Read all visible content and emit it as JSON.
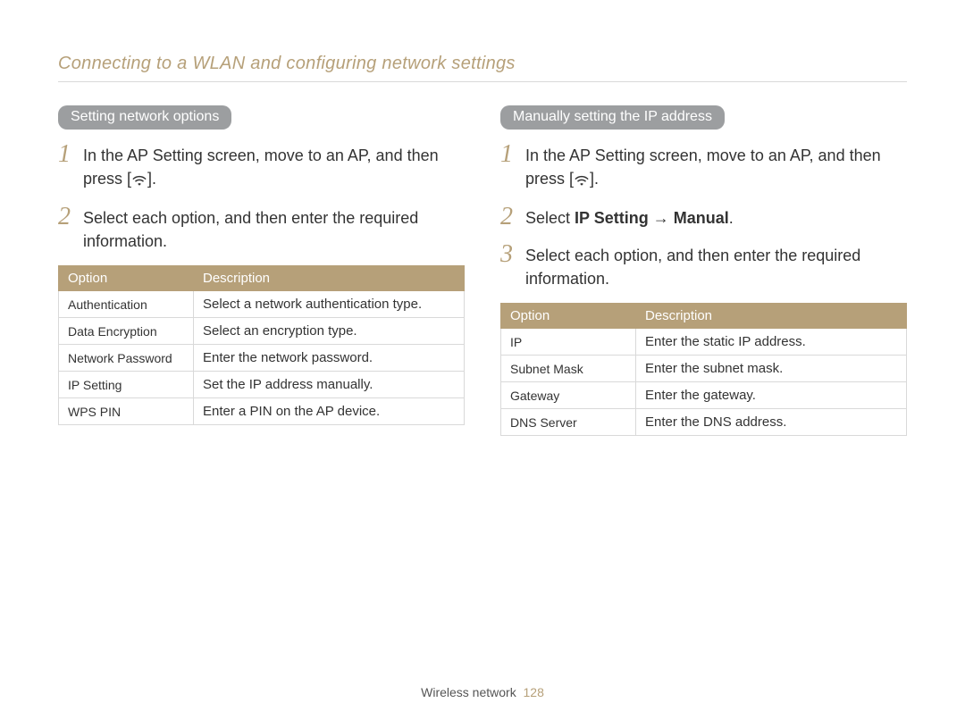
{
  "breadcrumb": "Connecting to a WLAN and configuring network settings",
  "left": {
    "heading": "Setting network options",
    "step1_pre": "In the AP Setting screen, move to an AP, and then press [",
    "step1_post": "].",
    "step2": "Select each option, and then enter the required information.",
    "table": {
      "col1": "Option",
      "col2": "Description",
      "rows": [
        {
          "opt": "Authentication",
          "desc": "Select a network authentication type."
        },
        {
          "opt": "Data Encryption",
          "desc": "Select an encryption type."
        },
        {
          "opt": "Network Password",
          "desc": "Enter the network password."
        },
        {
          "opt": "IP Setting",
          "desc": "Set the IP address manually."
        },
        {
          "opt": "WPS PIN",
          "desc": "Enter a PIN on the AP device."
        }
      ]
    }
  },
  "right": {
    "heading": "Manually setting the IP address",
    "step1_pre": "In the AP Setting screen, move to an AP, and then press [",
    "step1_post": "].",
    "step2_pre": "Select ",
    "step2_bold1": "IP Setting",
    "step2_arrow": " → ",
    "step2_bold2": "Manual",
    "step2_post": ".",
    "step3": "Select each option, and then enter the required information.",
    "table": {
      "col1": "Option",
      "col2": "Description",
      "rows": [
        {
          "opt": "IP",
          "desc": "Enter the static IP address."
        },
        {
          "opt": "Subnet Mask",
          "desc": "Enter the subnet mask."
        },
        {
          "opt": "Gateway",
          "desc": "Enter the gateway."
        },
        {
          "opt": "DNS Server",
          "desc": "Enter the DNS address."
        }
      ]
    }
  },
  "footer": {
    "section": "Wireless network",
    "page": "128"
  }
}
